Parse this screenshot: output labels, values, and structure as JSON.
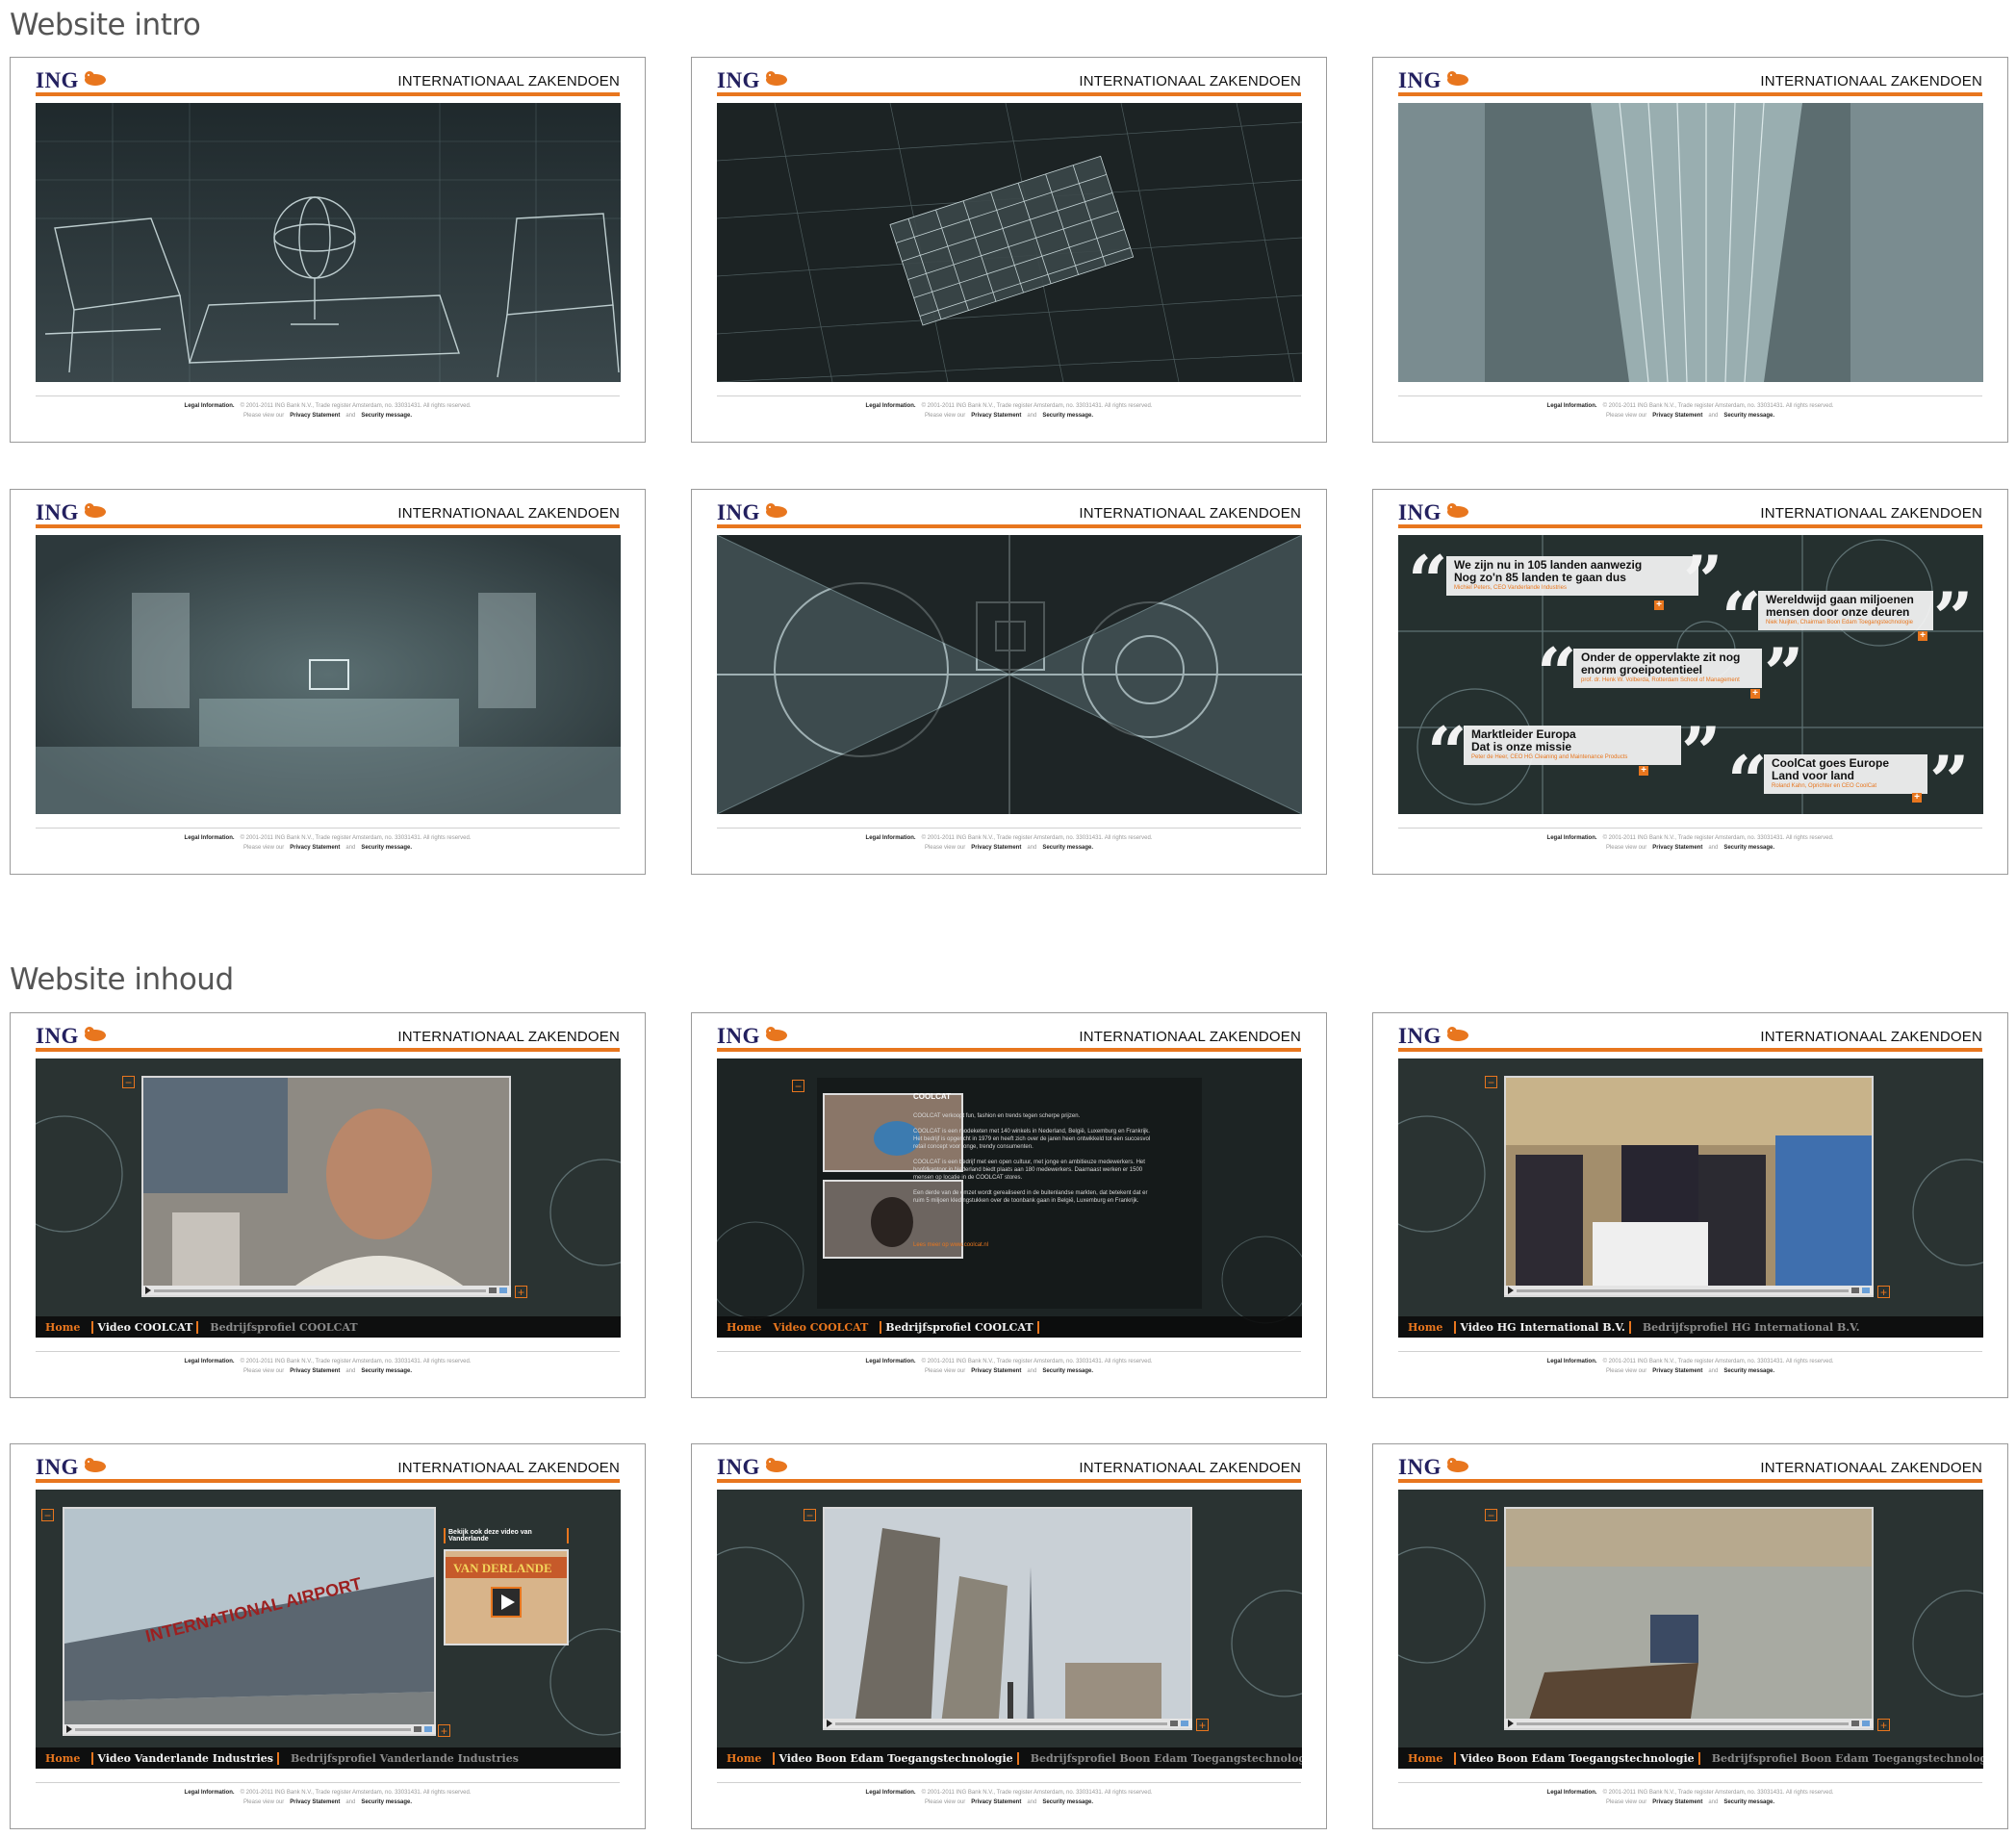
{
  "sections": {
    "intro_title": "Website intro",
    "content_title": "Website inhoud"
  },
  "brand": {
    "logo_text": "ING",
    "site_title": "INTERNATIONAAL ZAKENDOEN",
    "accent_color": "#e8761e",
    "logo_color": "#23205f"
  },
  "footer": {
    "legal": "Legal Information.",
    "copyright": "© 2001-2011 ING Bank N.V., Trade register Amsterdam, no. 33031431. All rights reserved.",
    "privacy_prefix": "Please view our",
    "privacy": "Privacy Statement",
    "and": "and",
    "security": "Security message."
  },
  "quotes": [
    {
      "text": "We zijn nu in 105 landen aanwezig\nNog zo'n 85 landen te gaan dus",
      "author": "Michiel Peters, CEO Vanderlande Industries"
    },
    {
      "text": "Wereldwijd gaan miljoenen\nmensen door onze deuren",
      "author": "Niek Nuijten, Chairman Boon Edam Toegangstechnologie"
    },
    {
      "text": "Onder de oppervlakte zit nog\nenorm groeipotentieel",
      "author": "prof. dr. Henk W. Volberda, Rotterdam School of Management"
    },
    {
      "text": "Marktleider Europa\nDat is onze missie",
      "author": "Peter de Heer, CEO HG Cleaning and Maintenance Products"
    },
    {
      "text": "CoolCat goes Europe\nLand voor land",
      "author": "Roland Kahn, Oprichter en CEO CoolCat"
    }
  ],
  "nav": {
    "home": "Home",
    "video_coolcat": "Video COOLCAT",
    "profile_coolcat": "Bedrijfsprofiel COOLCAT",
    "video_hg": "Video HG International B.V.",
    "profile_hg": "Bedrijfsprofiel HG International B.V.",
    "video_vanderlande": "Video Vanderlande Industries",
    "profile_vanderlande": "Bedrijfsprofiel Vanderlande Industries",
    "video_boon": "Video Boon Edam Toegangstechnologie",
    "profile_boon": "Bedrijfsprofiel Boon Edam Toegangstechnologie"
  },
  "coolcat_info": {
    "title": "COOLCAT",
    "body": "COOLCAT verkoopt fun, fashion en trends tegen scherpe prijzen.\n\nCOOLCAT is een modeketen met 140 winkels in Nederland, België, Luxemburg en Frankrijk. Het bedrijf is opgericht in 1979 en heeft zich over de jaren heen ontwikkeld tot een succesvol retail concept voor jonge, trendy consumenten.\n\nCOOLCAT is een bedrijf met een open cultuur, met jonge en ambitieuze medewerkers. Het hoofdkantoor in Nederland biedt plaats aan 180 medewerkers. Daarnaast werken er 1500 mensen op locatie in de COOLCAT stores.\n\nEen derde van de omzet wordt gerealiseerd in de buitenlandse markten, dat betekent dat er ruim 5 miljoen kledingstukken over de toonbank gaan in België, Luxemburg en Frankrijk.",
    "link": "Lees meer op www.coolcat.nl"
  },
  "vanderlande_promo": {
    "label": "Bekijk ook deze video van Vanderlande",
    "sign_text": "INTERNATIONAL AIRPORT",
    "thumb_sign": "VAN DERLANDE"
  }
}
